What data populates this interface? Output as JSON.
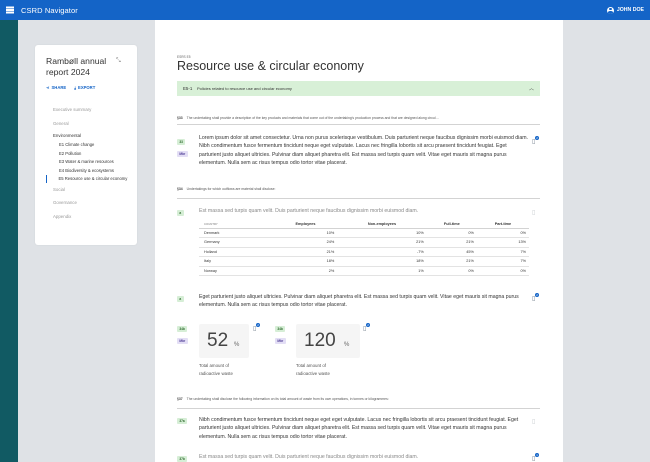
{
  "app": {
    "title": "CSRD Navigator",
    "user": "JOHN DOE"
  },
  "sidebar": {
    "report_title": "Rambøll annual report 2024",
    "share": "SHARE",
    "export": "EXPORT",
    "nav": [
      {
        "label": "Executive summary"
      },
      {
        "label": "General"
      },
      {
        "label": "Environmental"
      },
      {
        "label": "Social"
      },
      {
        "label": "Governance"
      },
      {
        "label": "Appendix"
      }
    ],
    "env_items": [
      {
        "label": "E1 Climate change"
      },
      {
        "label": "E2 Pollution"
      },
      {
        "label": "E3 Water & marine resources"
      },
      {
        "label": "E4 Biodiversity & ecosystems"
      },
      {
        "label": "E5 Resource use & circular economy"
      }
    ]
  },
  "main": {
    "section_code": "ESRS E5",
    "title": "Resource use & circular economy",
    "banner": {
      "code": "E5-1",
      "text": "Policies related to resource use and circular economy"
    },
    "req1": {
      "num": "§33",
      "text": "The undertaking shall provide a description of the key products and materials that come out of the undertaking's production process and that are designed along circul…"
    },
    "block1": {
      "tag1": "33",
      "tag2": "Mbr",
      "text": "Lorem ipsum dolor sit amet consectetur. Urna non purus scelerisque vestibulum. Duis parturient neque faucibus dignissim morbi euismod diam. Nibh condimentum fusce fermentum tincidunt neque eget vulputate. Lacus nec fringilla lobortis sit arcu praesent tincidunt feugiat. Eget parturient justo aliquet ultricies. Pulvinar diam aliquet pharetra elit. Est massa sed turpis quam velit. Vitae eget mauris sit magna purus elementum. Nulla sem ac risus tempus odio tortor vitae placerat.",
      "badge": "2"
    },
    "req2": {
      "num": "§34",
      "text": "Undertakings for which outflows are material shall disclose:"
    },
    "block2": {
      "tag": "a",
      "text": "Est massa sed turpis quam velit. Duis parturient neque faucibus dignissim morbi euismod diam."
    },
    "table": {
      "headers": [
        "COUNTRY",
        "Employees",
        "Non-employees",
        "Full-time",
        "Part-time"
      ],
      "rows": [
        [
          "Denmark",
          "10%",
          "10%",
          "0%",
          "0%"
        ],
        [
          "Germany",
          "24%",
          "21%",
          "21%",
          "13%"
        ],
        [
          "Holland",
          "21%",
          "-7%",
          "45%",
          "7%"
        ],
        [
          "Italy",
          "18%",
          "18%",
          "21%",
          "7%"
        ],
        [
          "Norway",
          "2%",
          "1%",
          "0%",
          "0%"
        ]
      ]
    },
    "block3": {
      "tag": "a",
      "text": "Eget parturient justo aliquet ultricies. Pulvinar diam aliquet pharetra elit. Est massa sed turpis quam velit. Vitae eget mauris sit magna purus elementum. Nulla sem ac risus tempus odio tortor vitae placerat.",
      "badge": "2"
    },
    "metrics": [
      {
        "tag1": "34b",
        "tag2": "Mbr",
        "value": "52",
        "unit": "%",
        "label": "Total amount of radioactive waste",
        "badge": "2"
      },
      {
        "tag1": "34b",
        "tag2": "Mbr",
        "value": "120",
        "unit": "%",
        "label": "Total amount of radioactive waste",
        "badge": "2"
      }
    ],
    "req3": {
      "num": "§37",
      "text": "The undertaking shall disclose the following information on its total amount of waste from its own operations, in tonnes or kilogrammes:"
    },
    "block4": {
      "tag": "37a",
      "text": "Nibh condimentum fusce fermentum tincidunt neque eget eget vulputate. Lacus nec fringilla lobortis sit arcu praesent tincidunt feugiat. Eget parturient justo aliquet ultricies. Pulvinar diam aliquet pharetra elit. Est massa sed turpis quam velit. Vitae eget mauris sit magna purus elementum. Nulla sem ac risus tempus odio tortor vitae placerat."
    },
    "block5": {
      "tag": "37b",
      "text": "Est massa sed turpis quam velit. Duis parturient neque faucibus dignissim morbi euismod diam.",
      "badge": "1"
    }
  }
}
